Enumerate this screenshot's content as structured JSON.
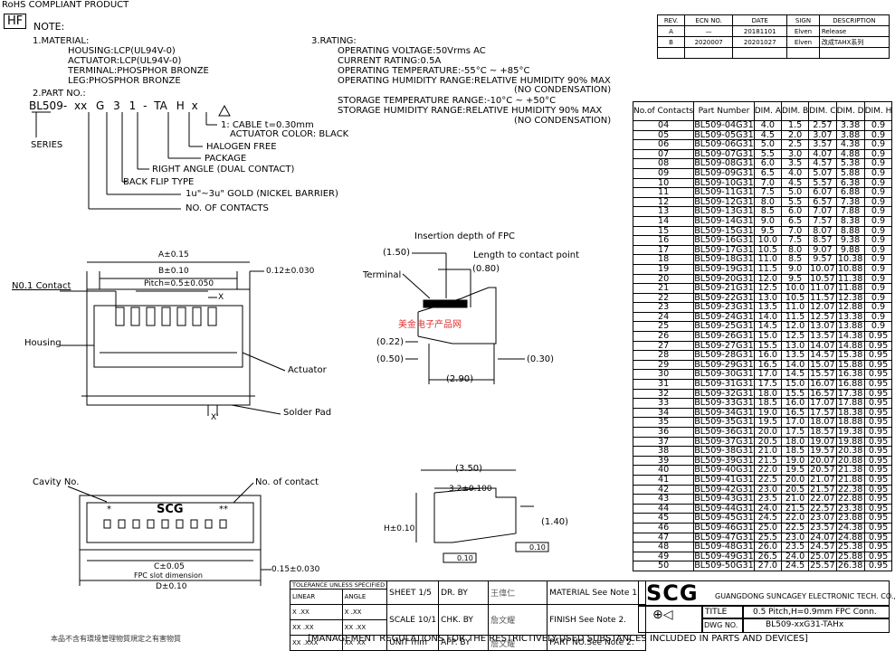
{
  "header": {
    "rohs": "RoHS  COMPLIANT  PRODUCT",
    "hf": "HF",
    "note_title": "NOTE:"
  },
  "material": {
    "title": "1.MATERIAL:",
    "lines": [
      "HOUSING:LCP(UL94V-0)",
      "ACTUATOR:LCP(UL94V-0)",
      "TERMINAL:PHOSPHOR BRONZE",
      "LEG:PHOSPHOR BRONZE"
    ]
  },
  "part_no": {
    "title": "2.PART NO.:",
    "code_parts": [
      "BL509-",
      "xx",
      "G",
      "3",
      "1",
      "-",
      "TA",
      "H",
      "x"
    ],
    "series": "SERIES",
    "callouts": [
      "1: CABLE t=0.30mm",
      "ACTUATOR COLOR: BLACK",
      "HALOGEN FREE",
      "PACKAGE",
      "RIGHT ANGLE (DUAL CONTACT)",
      "BACK FLIP TYPE",
      "1u\"~3u\" GOLD (NICKEL BARRIER)",
      "NO. OF CONTACTS"
    ]
  },
  "rating": {
    "title": "3.RATING:",
    "lines": [
      "OPERATING VOLTAGE:50Vrms AC",
      "CURRENT RATING:0.5A",
      "OPERATING TEMPERATURE:-55°C ~ +85°C",
      "OPERATING HUMIDITY RANGE:RELATIVE HUMIDITY 90% MAX",
      "(NO CONDENSATION)",
      "STORAGE TEMPERATURE RANGE:-10°C ~ +50°C",
      "STORAGE HUMIDITY RANGE:RELATIVE HUMIDITY 90% MAX",
      "(NO CONDENSATION)"
    ]
  },
  "revision": {
    "headers": [
      "REV.",
      "ECN NO.",
      "DATE",
      "SIGN",
      "DESCRIPTION"
    ],
    "rows": [
      [
        "A",
        "—",
        "20181101",
        "Elven",
        "Release"
      ],
      [
        "B",
        "2020007",
        "20201027",
        "Elven",
        "改成TAHX系列"
      ]
    ]
  },
  "dim_table": {
    "headers": [
      "No.of Contacts",
      "Part Number",
      "DIM. A",
      "DIM. B",
      "DIM. C",
      "DIM. D",
      "DIM. H"
    ],
    "rows": [
      [
        "04",
        "BL509-04G31",
        "4.0",
        "1.5",
        "2.57",
        "3.38",
        "0.9"
      ],
      [
        "05",
        "BL509-05G31",
        "4.5",
        "2.0",
        "3.07",
        "3.88",
        "0.9"
      ],
      [
        "06",
        "BL509-06G31",
        "5.0",
        "2.5",
        "3.57",
        "4.38",
        "0.9"
      ],
      [
        "07",
        "BL509-07G31",
        "5.5",
        "3.0",
        "4.07",
        "4.88",
        "0.9"
      ],
      [
        "08",
        "BL509-08G31",
        "6.0",
        "3.5",
        "4.57",
        "5.38",
        "0.9"
      ],
      [
        "09",
        "BL509-09G31",
        "6.5",
        "4.0",
        "5.07",
        "5.88",
        "0.9"
      ],
      [
        "10",
        "BL509-10G31",
        "7.0",
        "4.5",
        "5.57",
        "6.38",
        "0.9"
      ],
      [
        "11",
        "BL509-11G31",
        "7.5",
        "5.0",
        "6.07",
        "6.88",
        "0.9"
      ],
      [
        "12",
        "BL509-12G31",
        "8.0",
        "5.5",
        "6.57",
        "7.38",
        "0.9"
      ],
      [
        "13",
        "BL509-13G31",
        "8.5",
        "6.0",
        "7.07",
        "7.88",
        "0.9"
      ],
      [
        "14",
        "BL509-14G31",
        "9.0",
        "6.5",
        "7.57",
        "8.38",
        "0.9"
      ],
      [
        "15",
        "BL509-15G31",
        "9.5",
        "7.0",
        "8.07",
        "8.88",
        "0.9"
      ],
      [
        "16",
        "BL509-16G31",
        "10.0",
        "7.5",
        "8.57",
        "9.38",
        "0.9"
      ],
      [
        "17",
        "BL509-17G31",
        "10.5",
        "8.0",
        "9.07",
        "9.88",
        "0.9"
      ],
      [
        "18",
        "BL509-18G31",
        "11.0",
        "8.5",
        "9.57",
        "10.38",
        "0.9"
      ],
      [
        "19",
        "BL509-19G31",
        "11.5",
        "9.0",
        "10.07",
        "10.88",
        "0.9"
      ],
      [
        "20",
        "BL509-20G31",
        "12.0",
        "9.5",
        "10.57",
        "11.38",
        "0.9"
      ],
      [
        "21",
        "BL509-21G31",
        "12.5",
        "10.0",
        "11.07",
        "11.88",
        "0.9"
      ],
      [
        "22",
        "BL509-22G31",
        "13.0",
        "10.5",
        "11.57",
        "12.38",
        "0.9"
      ],
      [
        "23",
        "BL509-23G31",
        "13.5",
        "11.0",
        "12.07",
        "12.88",
        "0.9"
      ],
      [
        "24",
        "BL509-24G31",
        "14.0",
        "11.5",
        "12.57",
        "13.38",
        "0.9"
      ],
      [
        "25",
        "BL509-25G31",
        "14.5",
        "12.0",
        "13.07",
        "13.88",
        "0.9"
      ],
      [
        "26",
        "BL509-26G31",
        "15.0",
        "12.5",
        "13.57",
        "14.38",
        "0.95"
      ],
      [
        "27",
        "BL509-27G31",
        "15.5",
        "13.0",
        "14.07",
        "14.88",
        "0.95"
      ],
      [
        "28",
        "BL509-28G31",
        "16.0",
        "13.5",
        "14.57",
        "15.38",
        "0.95"
      ],
      [
        "29",
        "BL509-29G31",
        "16.5",
        "14.0",
        "15.07",
        "15.88",
        "0.95"
      ],
      [
        "30",
        "BL509-30G31",
        "17.0",
        "14.5",
        "15.57",
        "16.38",
        "0.95"
      ],
      [
        "31",
        "BL509-31G31",
        "17.5",
        "15.0",
        "16.07",
        "16.88",
        "0.95"
      ],
      [
        "32",
        "BL509-32G31",
        "18.0",
        "15.5",
        "16.57",
        "17.38",
        "0.95"
      ],
      [
        "33",
        "BL509-33G31",
        "18.5",
        "16.0",
        "17.07",
        "17.88",
        "0.95"
      ],
      [
        "34",
        "BL509-34G31",
        "19.0",
        "16.5",
        "17.57",
        "18.38",
        "0.95"
      ],
      [
        "35",
        "BL509-35G31",
        "19.5",
        "17.0",
        "18.07",
        "18.88",
        "0.95"
      ],
      [
        "36",
        "BL509-36G31",
        "20.0",
        "17.5",
        "18.57",
        "19.38",
        "0.95"
      ],
      [
        "37",
        "BL509-37G31",
        "20.5",
        "18.0",
        "19.07",
        "19.88",
        "0.95"
      ],
      [
        "38",
        "BL509-38G31",
        "21.0",
        "18.5",
        "19.57",
        "20.38",
        "0.95"
      ],
      [
        "39",
        "BL509-39G31",
        "21.5",
        "19.0",
        "20.07",
        "20.88",
        "0.95"
      ],
      [
        "40",
        "BL509-40G31",
        "22.0",
        "19.5",
        "20.57",
        "21.38",
        "0.95"
      ],
      [
        "41",
        "BL509-41G31",
        "22.5",
        "20.0",
        "21.07",
        "21.88",
        "0.95"
      ],
      [
        "42",
        "BL509-42G31",
        "23.0",
        "20.5",
        "21.57",
        "22.38",
        "0.95"
      ],
      [
        "43",
        "BL509-43G31",
        "23.5",
        "21.0",
        "22.07",
        "22.88",
        "0.95"
      ],
      [
        "44",
        "BL509-44G31",
        "24.0",
        "21.5",
        "22.57",
        "23.38",
        "0.95"
      ],
      [
        "45",
        "BL509-45G31",
        "24.5",
        "22.0",
        "23.07",
        "23.88",
        "0.95"
      ],
      [
        "46",
        "BL509-46G31",
        "25.0",
        "22.5",
        "23.57",
        "24.38",
        "0.95"
      ],
      [
        "47",
        "BL509-47G31",
        "25.5",
        "23.0",
        "24.07",
        "24.88",
        "0.95"
      ],
      [
        "48",
        "BL509-48G31",
        "26.0",
        "23.5",
        "24.57",
        "25.38",
        "0.95"
      ],
      [
        "49",
        "BL509-49G31",
        "26.5",
        "24.0",
        "25.07",
        "25.88",
        "0.95"
      ],
      [
        "50",
        "BL509-50G31",
        "27.0",
        "24.5",
        "25.57",
        "26.38",
        "0.95"
      ]
    ]
  },
  "front_view": {
    "dim_a": "A±0.15",
    "dim_b": "B±0.10",
    "dim_pitch": "Pitch=0.5±0.050",
    "dim_012": "0.12±0.030",
    "x_label": "X",
    "x_prime": "X'",
    "no1_contact": "N0.1 Contact",
    "housing": "Housing",
    "actuator": "Actuator",
    "solder_pad": "Solder Pad"
  },
  "side_view": {
    "title": "Insertion depth of FPC",
    "d150": "(1.50)",
    "length_label": "Length to contact point",
    "d080": "(0.80)",
    "terminal": "Terminal",
    "d022": "(0.22)",
    "d050": "(0.50)",
    "d030": "(0.30)",
    "d290": "(2.90)"
  },
  "bottom_view": {
    "cavity": "Cavity No.",
    "contact_no": "No. of contact",
    "logo": "SCG",
    "c_dim": "C±0.05",
    "fpc_slot": "FPC slot dimension",
    "d_dim": "D±0.10",
    "d015": "0.15±0.030"
  },
  "profile_view": {
    "d350": "(3.50)",
    "d320": "3.2±0.100",
    "h_dim": "H±0.10",
    "d140": "(1.40)",
    "tol010": "0.10"
  },
  "title_block": {
    "tolerance": "TOLERANCE UNLESS SPECIFIED",
    "linear": "LINEAR",
    "angle": "ANGLE",
    "lin_rows": [
      "X .XX",
      "XX .XX",
      "XX .XXX"
    ],
    "ang_rows": [
      "X .XX",
      "XX .XX",
      "XX' XX"
    ],
    "sheet": "SHEET 1/5",
    "scale": "SCALE 10/1",
    "unit": "UNIT   mm",
    "dr_by": "DR. BY",
    "chk_by": "CHK. BY",
    "app_by": "APP. BY",
    "dr_name": "王偉仁",
    "chk_name": "詹文耀",
    "app_name": "詹文耀",
    "material": "MATERIAL See Note 1.",
    "finish": "FINISH     See Note 2.",
    "part_no": "PART NO.See Note 2.",
    "company_logo": "SCG",
    "company": "GUANGDONG SUNCAGEY ELECTRONIC TECH. CO., LTD.",
    "title_label": "TITLE",
    "title_val": "0.5 Pitch,H=0.9mm FPC Conn.",
    "dwg_label": "DWG NO.",
    "dwg_val": "BL509-xxG31-TAHx"
  },
  "footer": {
    "chinese": "本品不含有環境管理物質規定之有害物質",
    "english": "[MANAGEMENT REGULATIONS FOR THE RESTRICTIVELY-USED SUBSTANCES INCLUDED IN PARTS AND DEVICES]"
  },
  "watermark": "美金电子产品网"
}
